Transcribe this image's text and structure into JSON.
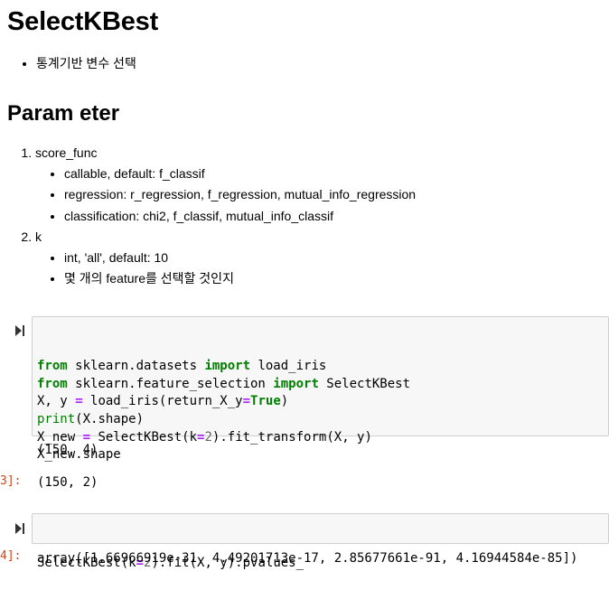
{
  "markdown": {
    "title": "SelectKBest",
    "intro_item": "통계기반 변수 선택",
    "param_heading": "Param eter",
    "params": [
      {
        "label": "score_func",
        "sub": [
          "callable, default: f_classif",
          "regression: r_regression, f_regression, mutual_info_regression",
          "classification: chi2, f_classif, mutual_info_classif"
        ]
      },
      {
        "label": "k",
        "sub": [
          "int, 'all', default: 10",
          "몇 개의 feature를 선택할 것인지"
        ]
      }
    ]
  },
  "cells": {
    "cell1": {
      "lines": [
        [
          [
            "kw",
            "from"
          ],
          [
            "tok",
            " sklearn.datasets "
          ],
          [
            "kw",
            "import"
          ],
          [
            "tok",
            " load_iris"
          ]
        ],
        [
          [
            "kw",
            "from"
          ],
          [
            "tok",
            " sklearn.feature_selection "
          ],
          [
            "kw",
            "import"
          ],
          [
            "tok",
            " SelectKBest"
          ]
        ],
        [
          [
            "tok",
            "X, y "
          ],
          [
            "op",
            "="
          ],
          [
            "tok",
            " load_iris(return_X_y"
          ],
          [
            "op",
            "="
          ],
          [
            "kw",
            "True"
          ],
          [
            "tok",
            ")"
          ]
        ],
        [
          [
            "bi",
            "print"
          ],
          [
            "tok",
            "(X.shape)"
          ]
        ],
        [
          [
            "tok",
            "X_new "
          ],
          [
            "op",
            "="
          ],
          [
            "tok",
            " SelectKBest(k"
          ],
          [
            "op",
            "="
          ],
          [
            "num",
            "2"
          ],
          [
            "tok",
            ").fit_transform(X, y)"
          ]
        ],
        [
          [
            "tok",
            "X_new.shape"
          ]
        ]
      ],
      "stdout": "(150, 4)",
      "out_prompt": "3]:",
      "result": "(150, 2)"
    },
    "cell2": {
      "lines": [
        [
          [
            "tok",
            "SelectKBest(k"
          ],
          [
            "op",
            "="
          ],
          [
            "num",
            "2"
          ],
          [
            "tok",
            ").fit(X, y).pvalues_"
          ]
        ]
      ],
      "out_prompt": "4]:",
      "result": "array([1.66966919e-31, 4.49201713e-17, 2.85677661e-91, 4.16944584e-85])"
    }
  }
}
